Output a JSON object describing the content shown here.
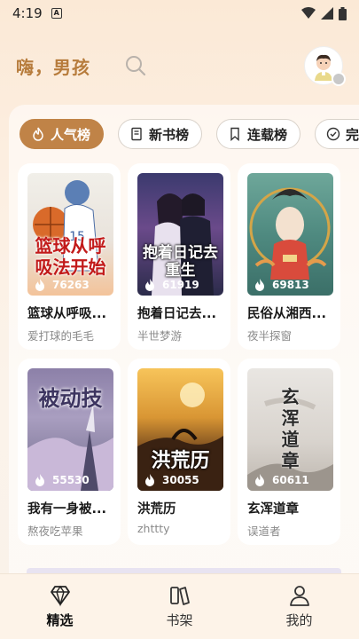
{
  "status": {
    "time": "4:19",
    "notification": "A"
  },
  "header": {
    "greeting": "嗨，男孩"
  },
  "tabs": [
    {
      "label": "人气榜",
      "active": true,
      "icon": "flame-icon"
    },
    {
      "label": "新书榜",
      "active": false,
      "icon": "book-icon"
    },
    {
      "label": "连载榜",
      "active": false,
      "icon": "bookmark-icon"
    },
    {
      "label": "完",
      "active": false,
      "icon": "check-circle-icon"
    }
  ],
  "books": [
    {
      "title": "篮球从呼吸...",
      "author": "爱打球的毛毛",
      "hot": "76263",
      "cover_text": "篮球从呼吸法开始"
    },
    {
      "title": "抱着日记去...",
      "author": "半世梦游",
      "hot": "61919",
      "cover_text": "抱着日记去重生"
    },
    {
      "title": "民俗从湘西...",
      "author": "夜半探窗",
      "hot": "69813",
      "cover_text": ""
    },
    {
      "title": "我有一身被...",
      "author": "熬夜吃苹果",
      "hot": "55530",
      "cover_text": "被动技"
    },
    {
      "title": "洪荒历",
      "author": "zhttty",
      "hot": "30055",
      "cover_text": "洪荒历"
    },
    {
      "title": "玄浑道章",
      "author": "误道者",
      "hot": "60611",
      "cover_text": "玄浑道章"
    }
  ],
  "nav": [
    {
      "label": "精选",
      "active": true
    },
    {
      "label": "书架",
      "active": false
    },
    {
      "label": "我的",
      "active": false
    }
  ]
}
